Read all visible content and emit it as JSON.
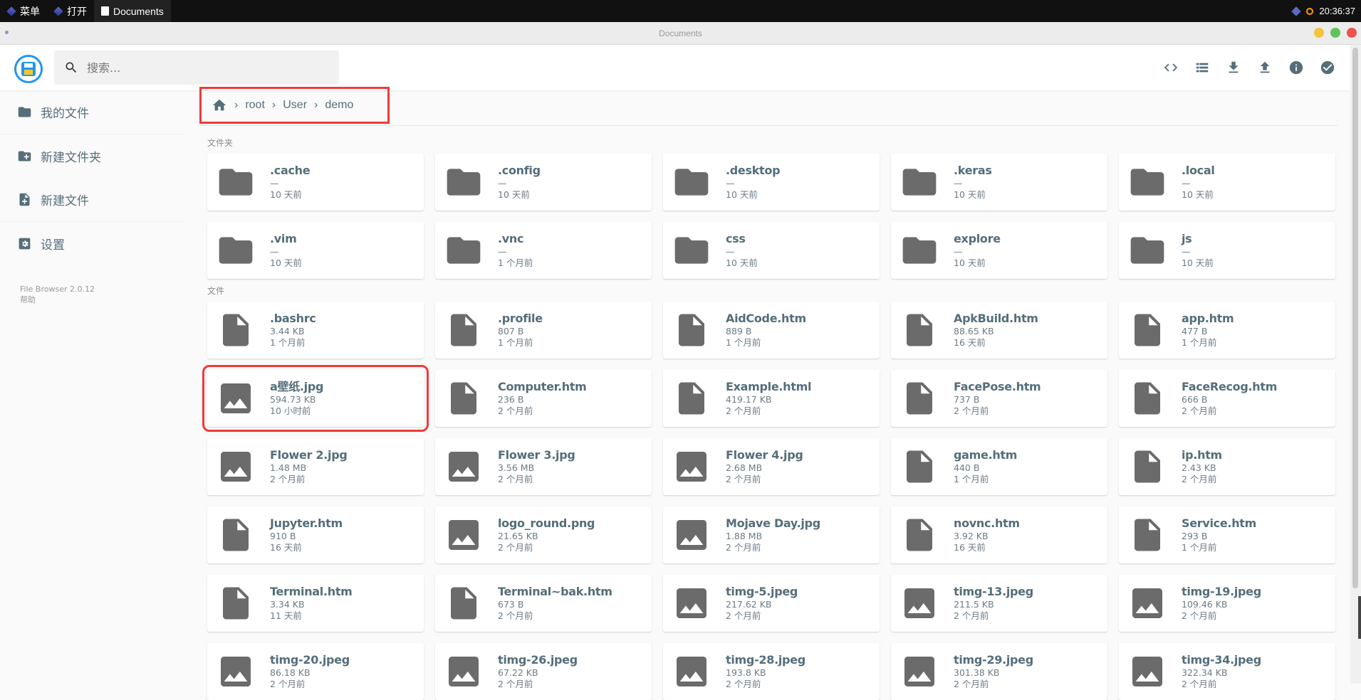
{
  "taskbar": {
    "menu_label": "菜单",
    "open_label": "打开",
    "active_window": "Documents",
    "clock": "20:36:37"
  },
  "window": {
    "title": "Documents"
  },
  "search": {
    "placeholder": "搜索..."
  },
  "header_actions": [
    "code-view-icon",
    "list-view-icon",
    "download-icon",
    "upload-icon",
    "info-icon",
    "select-check-icon"
  ],
  "sidebar": {
    "items": [
      {
        "label": "我的文件",
        "icon": "folder-icon"
      },
      {
        "label": "新建文件夹",
        "icon": "new-folder-icon"
      },
      {
        "label": "新建文件",
        "icon": "new-file-icon"
      },
      {
        "label": "设置",
        "icon": "settings-icon"
      }
    ],
    "version": "File Browser 2.0.12",
    "help": "帮助"
  },
  "breadcrumb": [
    "root",
    "User",
    "demo"
  ],
  "sections": {
    "folders": "文件夹",
    "files": "文件"
  },
  "folders": [
    {
      "name": ".cache",
      "size": "—",
      "modified": "10 天前"
    },
    {
      "name": ".config",
      "size": "—",
      "modified": "10 天前"
    },
    {
      "name": ".desktop",
      "size": "—",
      "modified": "10 天前"
    },
    {
      "name": ".keras",
      "size": "—",
      "modified": "10 天前"
    },
    {
      "name": ".local",
      "size": "—",
      "modified": "10 天前"
    },
    {
      "name": ".vim",
      "size": "—",
      "modified": "10 天前"
    },
    {
      "name": ".vnc",
      "size": "—",
      "modified": "1 个月前"
    },
    {
      "name": "css",
      "size": "—",
      "modified": "10 天前"
    },
    {
      "name": "explore",
      "size": "—",
      "modified": "10 天前"
    },
    {
      "name": "js",
      "size": "—",
      "modified": "10 天前"
    }
  ],
  "files": [
    {
      "name": ".bashrc",
      "size": "3.44 KB",
      "modified": "1 个月前",
      "type": "file"
    },
    {
      "name": ".profile",
      "size": "807 B",
      "modified": "1 个月前",
      "type": "file"
    },
    {
      "name": "AidCode.htm",
      "size": "889 B",
      "modified": "1 个月前",
      "type": "file"
    },
    {
      "name": "ApkBuild.htm",
      "size": "88.65 KB",
      "modified": "16 天前",
      "type": "file"
    },
    {
      "name": "app.htm",
      "size": "477 B",
      "modified": "1 个月前",
      "type": "file"
    },
    {
      "name": "a壁纸.jpg",
      "size": "594.73 KB",
      "modified": "10 小时前",
      "type": "image",
      "highlight": true
    },
    {
      "name": "Computer.htm",
      "size": "236 B",
      "modified": "2 个月前",
      "type": "file"
    },
    {
      "name": "Example.html",
      "size": "419.17 KB",
      "modified": "2 个月前",
      "type": "file"
    },
    {
      "name": "FacePose.htm",
      "size": "737 B",
      "modified": "2 个月前",
      "type": "file"
    },
    {
      "name": "FaceRecog.htm",
      "size": "666 B",
      "modified": "2 个月前",
      "type": "file"
    },
    {
      "name": "Flower 2.jpg",
      "size": "1.48 MB",
      "modified": "2 个月前",
      "type": "image"
    },
    {
      "name": "Flower 3.jpg",
      "size": "3.56 MB",
      "modified": "2 个月前",
      "type": "image"
    },
    {
      "name": "Flower 4.jpg",
      "size": "2.68 MB",
      "modified": "2 个月前",
      "type": "image"
    },
    {
      "name": "game.htm",
      "size": "440 B",
      "modified": "1 个月前",
      "type": "file"
    },
    {
      "name": "ip.htm",
      "size": "2.43 KB",
      "modified": "2 个月前",
      "type": "file"
    },
    {
      "name": "Jupyter.htm",
      "size": "910 B",
      "modified": "16 天前",
      "type": "file"
    },
    {
      "name": "logo_round.png",
      "size": "21.65 KB",
      "modified": "2 个月前",
      "type": "image"
    },
    {
      "name": "Mojave Day.jpg",
      "size": "1.88 MB",
      "modified": "2 个月前",
      "type": "image"
    },
    {
      "name": "novnc.htm",
      "size": "3.92 KB",
      "modified": "16 天前",
      "type": "file"
    },
    {
      "name": "Service.htm",
      "size": "293 B",
      "modified": "1 个月前",
      "type": "file"
    },
    {
      "name": "Terminal.htm",
      "size": "3.34 KB",
      "modified": "11 天前",
      "type": "file"
    },
    {
      "name": "Terminal~bak.htm",
      "size": "673 B",
      "modified": "2 个月前",
      "type": "file"
    },
    {
      "name": "timg-5.jpeg",
      "size": "217.62 KB",
      "modified": "2 个月前",
      "type": "image"
    },
    {
      "name": "timg-13.jpeg",
      "size": "211.5 KB",
      "modified": "2 个月前",
      "type": "image"
    },
    {
      "name": "timg-19.jpeg",
      "size": "109.46 KB",
      "modified": "2 个月前",
      "type": "image"
    },
    {
      "name": "timg-20.jpeg",
      "size": "86.18 KB",
      "modified": "2 个月前",
      "type": "image"
    },
    {
      "name": "timg-26.jpeg",
      "size": "67.22 KB",
      "modified": "2 个月前",
      "type": "image"
    },
    {
      "name": "timg-28.jpeg",
      "size": "193.8 KB",
      "modified": "2 个月前",
      "type": "image"
    },
    {
      "name": "timg-29.jpeg",
      "size": "301.38 KB",
      "modified": "2 个月前",
      "type": "image"
    },
    {
      "name": "timg-34.jpeg",
      "size": "322.34 KB",
      "modified": "2 个月前",
      "type": "image"
    }
  ],
  "colors": {
    "accent": "#2196f3",
    "highlight": "#f03a3a",
    "text": "#546e7a",
    "icon": "#6b6b6b"
  }
}
